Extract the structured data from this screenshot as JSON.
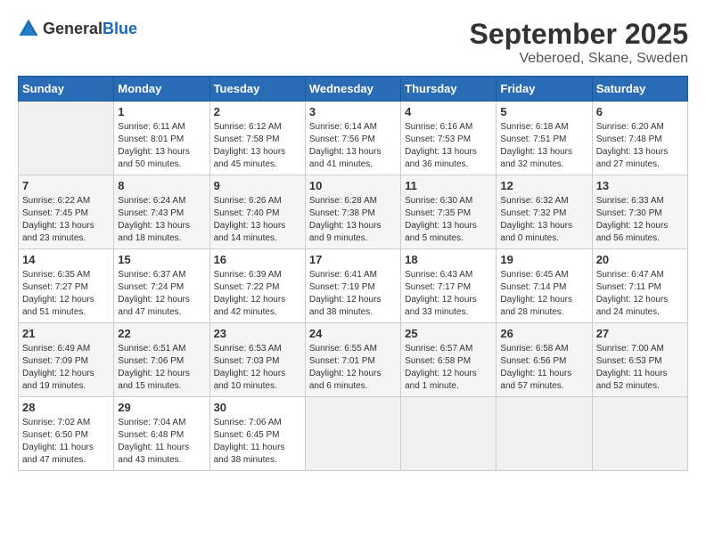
{
  "header": {
    "logo": {
      "text_general": "General",
      "text_blue": "Blue"
    },
    "title": "September 2025",
    "location": "Veberoed, Skane, Sweden"
  },
  "weekdays": [
    "Sunday",
    "Monday",
    "Tuesday",
    "Wednesday",
    "Thursday",
    "Friday",
    "Saturday"
  ],
  "weeks": [
    [
      {
        "day": "",
        "info": ""
      },
      {
        "day": "1",
        "info": "Sunrise: 6:11 AM\nSunset: 8:01 PM\nDaylight: 13 hours\nand 50 minutes."
      },
      {
        "day": "2",
        "info": "Sunrise: 6:12 AM\nSunset: 7:58 PM\nDaylight: 13 hours\nand 45 minutes."
      },
      {
        "day": "3",
        "info": "Sunrise: 6:14 AM\nSunset: 7:56 PM\nDaylight: 13 hours\nand 41 minutes."
      },
      {
        "day": "4",
        "info": "Sunrise: 6:16 AM\nSunset: 7:53 PM\nDaylight: 13 hours\nand 36 minutes."
      },
      {
        "day": "5",
        "info": "Sunrise: 6:18 AM\nSunset: 7:51 PM\nDaylight: 13 hours\nand 32 minutes."
      },
      {
        "day": "6",
        "info": "Sunrise: 6:20 AM\nSunset: 7:48 PM\nDaylight: 13 hours\nand 27 minutes."
      }
    ],
    [
      {
        "day": "7",
        "info": "Sunrise: 6:22 AM\nSunset: 7:45 PM\nDaylight: 13 hours\nand 23 minutes."
      },
      {
        "day": "8",
        "info": "Sunrise: 6:24 AM\nSunset: 7:43 PM\nDaylight: 13 hours\nand 18 minutes."
      },
      {
        "day": "9",
        "info": "Sunrise: 6:26 AM\nSunset: 7:40 PM\nDaylight: 13 hours\nand 14 minutes."
      },
      {
        "day": "10",
        "info": "Sunrise: 6:28 AM\nSunset: 7:38 PM\nDaylight: 13 hours\nand 9 minutes."
      },
      {
        "day": "11",
        "info": "Sunrise: 6:30 AM\nSunset: 7:35 PM\nDaylight: 13 hours\nand 5 minutes."
      },
      {
        "day": "12",
        "info": "Sunrise: 6:32 AM\nSunset: 7:32 PM\nDaylight: 13 hours\nand 0 minutes."
      },
      {
        "day": "13",
        "info": "Sunrise: 6:33 AM\nSunset: 7:30 PM\nDaylight: 12 hours\nand 56 minutes."
      }
    ],
    [
      {
        "day": "14",
        "info": "Sunrise: 6:35 AM\nSunset: 7:27 PM\nDaylight: 12 hours\nand 51 minutes."
      },
      {
        "day": "15",
        "info": "Sunrise: 6:37 AM\nSunset: 7:24 PM\nDaylight: 12 hours\nand 47 minutes."
      },
      {
        "day": "16",
        "info": "Sunrise: 6:39 AM\nSunset: 7:22 PM\nDaylight: 12 hours\nand 42 minutes."
      },
      {
        "day": "17",
        "info": "Sunrise: 6:41 AM\nSunset: 7:19 PM\nDaylight: 12 hours\nand 38 minutes."
      },
      {
        "day": "18",
        "info": "Sunrise: 6:43 AM\nSunset: 7:17 PM\nDaylight: 12 hours\nand 33 minutes."
      },
      {
        "day": "19",
        "info": "Sunrise: 6:45 AM\nSunset: 7:14 PM\nDaylight: 12 hours\nand 28 minutes."
      },
      {
        "day": "20",
        "info": "Sunrise: 6:47 AM\nSunset: 7:11 PM\nDaylight: 12 hours\nand 24 minutes."
      }
    ],
    [
      {
        "day": "21",
        "info": "Sunrise: 6:49 AM\nSunset: 7:09 PM\nDaylight: 12 hours\nand 19 minutes."
      },
      {
        "day": "22",
        "info": "Sunrise: 6:51 AM\nSunset: 7:06 PM\nDaylight: 12 hours\nand 15 minutes."
      },
      {
        "day": "23",
        "info": "Sunrise: 6:53 AM\nSunset: 7:03 PM\nDaylight: 12 hours\nand 10 minutes."
      },
      {
        "day": "24",
        "info": "Sunrise: 6:55 AM\nSunset: 7:01 PM\nDaylight: 12 hours\nand 6 minutes."
      },
      {
        "day": "25",
        "info": "Sunrise: 6:57 AM\nSunset: 6:58 PM\nDaylight: 12 hours\nand 1 minute."
      },
      {
        "day": "26",
        "info": "Sunrise: 6:58 AM\nSunset: 6:56 PM\nDaylight: 11 hours\nand 57 minutes."
      },
      {
        "day": "27",
        "info": "Sunrise: 7:00 AM\nSunset: 6:53 PM\nDaylight: 11 hours\nand 52 minutes."
      }
    ],
    [
      {
        "day": "28",
        "info": "Sunrise: 7:02 AM\nSunset: 6:50 PM\nDaylight: 11 hours\nand 47 minutes."
      },
      {
        "day": "29",
        "info": "Sunrise: 7:04 AM\nSunset: 6:48 PM\nDaylight: 11 hours\nand 43 minutes."
      },
      {
        "day": "30",
        "info": "Sunrise: 7:06 AM\nSunset: 6:45 PM\nDaylight: 11 hours\nand 38 minutes."
      },
      {
        "day": "",
        "info": ""
      },
      {
        "day": "",
        "info": ""
      },
      {
        "day": "",
        "info": ""
      },
      {
        "day": "",
        "info": ""
      }
    ]
  ]
}
